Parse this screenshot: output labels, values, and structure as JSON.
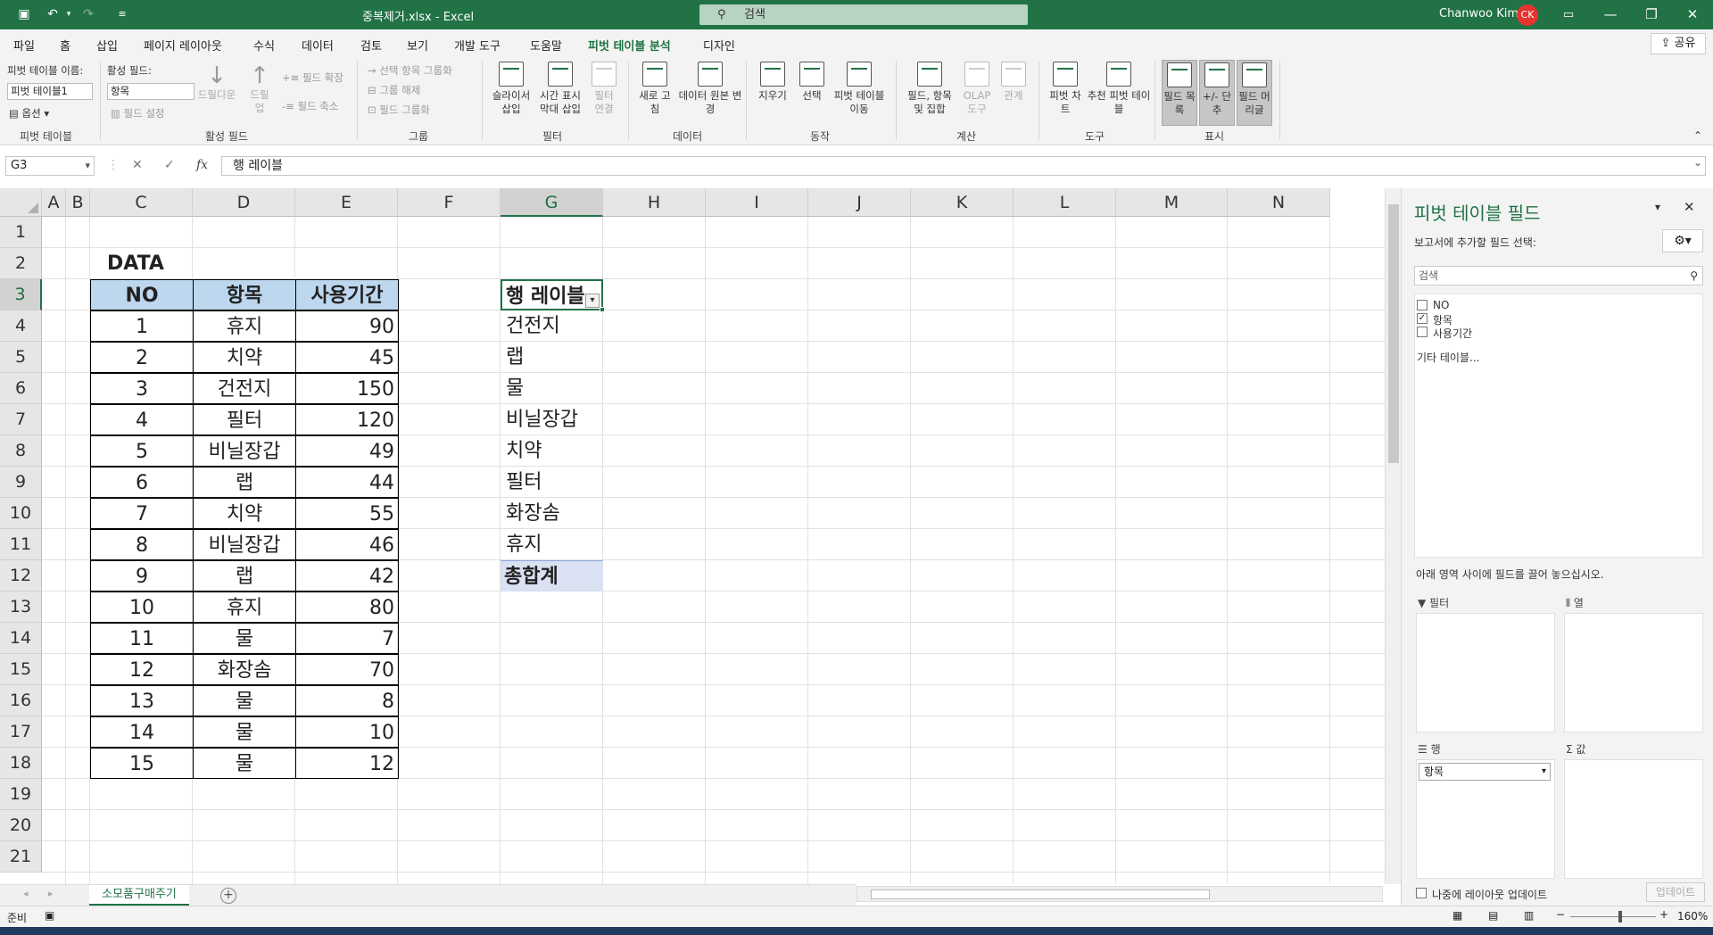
{
  "title": {
    "file": "중복제거.xlsx",
    "app": "Excel",
    "sep": " - ",
    "search": "검색",
    "user": "Chanwoo Kim",
    "initials": "CK"
  },
  "tabs": [
    "파일",
    "홈",
    "삽입",
    "페이지 레이아웃",
    "수식",
    "데이터",
    "검토",
    "보기",
    "개발 도구",
    "도움말",
    "피벗 테이블 분석",
    "디자인"
  ],
  "active_tab": "피벗 테이블 분석",
  "share": "공유",
  "ribbon": {
    "pt_name_label": "피벗 테이블 이름:",
    "pt_name": "피벗 테이블1",
    "options": "옵션",
    "active_field_label": "활성 필드:",
    "active_field": "항목",
    "field_settings": "필드 설정",
    "drilldown": "드릴다운",
    "drillup": "드릴 업",
    "expand": "필드 확장",
    "collapse": "필드 축소",
    "group_selection": "선택 항목 그룹화",
    "ungroup": "그룹 해제",
    "group_field": "필드 그룹화",
    "slicer": "슬라이서 삽입",
    "timeline": "시간 표시 막대 삽입",
    "filter_conn": "필터 연결",
    "refresh": "새로 고침",
    "change_source": "데이터 원본 변경",
    "clear": "지우기",
    "select": "선택",
    "move_pt": "피벗 테이블 이동",
    "fields_items": "필드, 항목 및 집합",
    "olap": "OLAP 도구",
    "relations": "관계",
    "pivotchart": "피벗 차트",
    "recommended": "추천 피벗 테이블",
    "field_list": "필드 목록",
    "plusminus": "+/- 단추",
    "field_headers": "필드 머리글",
    "groups": {
      "pt": "피벗 테이블",
      "af": "활성 필드",
      "grp": "그룹",
      "flt": "필터",
      "data": "데이터",
      "act": "동작",
      "calc": "계산",
      "tools": "도구",
      "show": "표시"
    }
  },
  "formula": {
    "cell": "G3",
    "cancel": "✕",
    "enter": "✓",
    "fx": "fx",
    "content": "행 레이블"
  },
  "columns": [
    "A",
    "B",
    "C",
    "D",
    "E",
    "F",
    "G",
    "H",
    "I",
    "J",
    "K",
    "L",
    "M",
    "N"
  ],
  "rows": [
    "1",
    "2",
    "3",
    "4",
    "5",
    "6",
    "7",
    "8",
    "9",
    "10",
    "11",
    "12",
    "13",
    "14",
    "15",
    "16",
    "17",
    "18",
    "19",
    "20",
    "21"
  ],
  "data_title": "DATA",
  "table": {
    "headers": [
      "NO",
      "항목",
      "사용기간"
    ],
    "rows": [
      [
        "1",
        "휴지",
        "90"
      ],
      [
        "2",
        "치약",
        "45"
      ],
      [
        "3",
        "건전지",
        "150"
      ],
      [
        "4",
        "필터",
        "120"
      ],
      [
        "5",
        "비닐장갑",
        "49"
      ],
      [
        "6",
        "랩",
        "44"
      ],
      [
        "7",
        "치약",
        "55"
      ],
      [
        "8",
        "비닐장갑",
        "46"
      ],
      [
        "9",
        "랩",
        "42"
      ],
      [
        "10",
        "휴지",
        "80"
      ],
      [
        "11",
        "물",
        "7"
      ],
      [
        "12",
        "화장솜",
        "70"
      ],
      [
        "13",
        "물",
        "8"
      ],
      [
        "14",
        "물",
        "10"
      ],
      [
        "15",
        "물",
        "12"
      ]
    ]
  },
  "pivot": {
    "header": "행 레이블",
    "items": [
      "건전지",
      "랩",
      "물",
      "비닐장갑",
      "치약",
      "필터",
      "화장솜",
      "휴지"
    ],
    "total": "총합계"
  },
  "sheet_tab": "소모품구매주기",
  "status": {
    "ready": "준비",
    "zoom": "160%"
  },
  "pane": {
    "title": "피벗 테이블 필드",
    "choose": "보고서에 추가할 필드 선택:",
    "search": "검색",
    "fields": [
      {
        "name": "NO",
        "checked": false
      },
      {
        "name": "항목",
        "checked": true
      },
      {
        "name": "사용기간",
        "checked": false
      }
    ],
    "more": "기타 테이블...",
    "drag_hint": "아래 영역 사이에 필드를 끌어 놓으십시오.",
    "filter": "필터",
    "columns": "열",
    "rows": "행",
    "values": "값",
    "row_field": "항목",
    "defer": "나중에 레이아웃 업데이트",
    "update": "업데이트"
  },
  "colors": {
    "excel_green": "#217346",
    "header_fill": "#bdd7ee",
    "total_fill": "#d9e1f2"
  }
}
